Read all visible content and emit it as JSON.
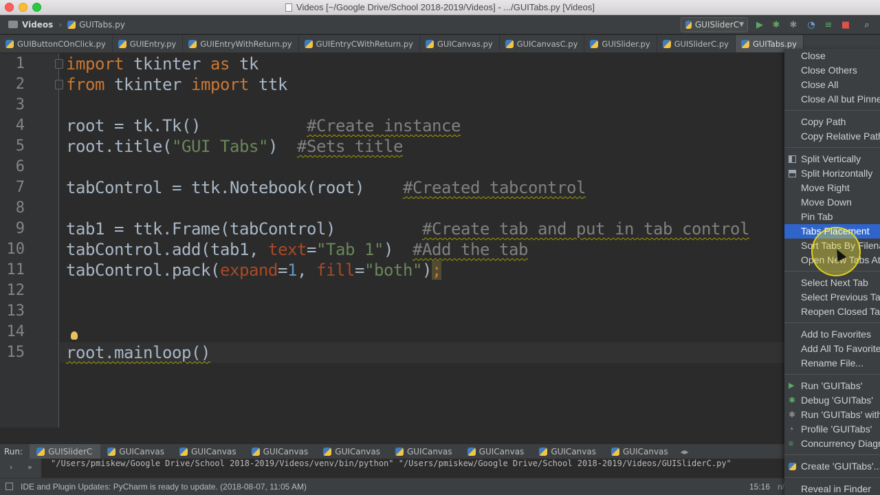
{
  "window": {
    "title": "Videos [~/Google Drive/School 2018-2019/Videos] - .../GUITabs.py [Videos]"
  },
  "navbar": {
    "project": "Videos",
    "file": "GUITabs.py",
    "run_config": "GUISliderC"
  },
  "editor_tabs": [
    {
      "label": "GUIButtonCOnClick.py"
    },
    {
      "label": "GUIEntry.py"
    },
    {
      "label": "GUIEntryWithReturn.py"
    },
    {
      "label": "GUIEntryCWithReturn.py"
    },
    {
      "label": "GUICanvas.py"
    },
    {
      "label": "GUICanvasC.py"
    },
    {
      "label": "GUISlider.py"
    },
    {
      "label": "GUISliderC.py"
    },
    {
      "label": "GUITabs.py"
    }
  ],
  "code": {
    "line_numbers": [
      "1",
      "2",
      "3",
      "4",
      "5",
      "6",
      "7",
      "8",
      "9",
      "10",
      "11",
      "12",
      "13",
      "14",
      "15"
    ],
    "l1": {
      "kw1": "import",
      "t1": " tkinter ",
      "kw2": "as",
      "t2": " tk"
    },
    "l2": {
      "kw1": "from",
      "t1": " tkinter ",
      "kw2": "import",
      "t2": " ttk"
    },
    "l4": {
      "t1": "root = tk.Tk()           ",
      "cm": "#Create instance"
    },
    "l5": {
      "t1": "root.title(",
      "s1": "\"GUI Tabs\"",
      "t2": ")  ",
      "cm": "#Sets title"
    },
    "l7": {
      "t1": "tabControl = ttk.Notebook(root)    ",
      "cm": "#Created tabcontrol"
    },
    "l9": {
      "t1": "tab1 = ttk.Frame(tabControl)         ",
      "cm": "#Create tab and put in tab control"
    },
    "l10": {
      "t1": "tabControl.add(tab1, ",
      "p1": "text",
      "t2": "=",
      "s1": "\"Tab 1\"",
      "t3": ")  ",
      "cm": "#Add the tab"
    },
    "l11": {
      "t1": "tabControl.pack(",
      "p1": "expand",
      "t2": "=",
      "n1": "1",
      "t3": ", ",
      "p2": "fill",
      "t4": "=",
      "s1": "\"both\"",
      "t5": ")",
      "semi": ";"
    },
    "l15": {
      "t1": "root.mainloop()"
    }
  },
  "run_panel": {
    "label": "Run:",
    "tabs": [
      {
        "label": "GUISliderC"
      },
      {
        "label": "GUICanvas"
      },
      {
        "label": "GUICanvas"
      },
      {
        "label": "GUICanvas"
      },
      {
        "label": "GUICanvas"
      },
      {
        "label": "GUICanvas"
      },
      {
        "label": "GUICanvas"
      },
      {
        "label": "GUICanvas"
      },
      {
        "label": "GUICanvas"
      }
    ],
    "console": "\"/Users/pmiskew/Google Drive/School 2018-2019/Videos/venv/bin/python\" \"/Users/pmiskew/Google Drive/School 2018-2019/Videos/GUISliderC.py\""
  },
  "status": {
    "message": "IDE and Plugin Updates: PyCharm is ready to update. (2018-08-07, 11:05 AM)",
    "position": "15:16",
    "extra": "n/"
  },
  "context_menu": {
    "items": [
      {
        "label": "Close"
      },
      {
        "label": "Close Others"
      },
      {
        "label": "Close All"
      },
      {
        "label": "Close All but Pinned"
      },
      {
        "label": "Copy Path"
      },
      {
        "label": "Copy Relative Path"
      },
      {
        "label": "Split Vertically"
      },
      {
        "label": "Split Horizontally"
      },
      {
        "label": "Move Right"
      },
      {
        "label": "Move Down"
      },
      {
        "label": "Pin Tab"
      },
      {
        "label": "Tabs Placement"
      },
      {
        "label": "Sort Tabs By Filename"
      },
      {
        "label": "Open New Tabs At The End"
      },
      {
        "label": "Select Next Tab"
      },
      {
        "label": "Select Previous Tab"
      },
      {
        "label": "Reopen Closed Tab"
      },
      {
        "label": "Add to Favorites"
      },
      {
        "label": "Add All To Favorites"
      },
      {
        "label": "Rename File..."
      },
      {
        "label": "Run 'GUITabs'"
      },
      {
        "label": "Debug 'GUITabs'"
      },
      {
        "label": "Run 'GUITabs' with Coverage"
      },
      {
        "label": "Profile 'GUITabs'"
      },
      {
        "label": "Concurrency Diagram for 'GUITabs'"
      },
      {
        "label": "Create 'GUITabs'..."
      },
      {
        "label": "Reveal in Finder"
      }
    ]
  },
  "colors": {
    "keyword": "#cc7832",
    "string": "#6a8759",
    "comment": "#808080",
    "number": "#6897bb",
    "param": "#aa4926",
    "menu_highlight": "#2f65ca"
  }
}
